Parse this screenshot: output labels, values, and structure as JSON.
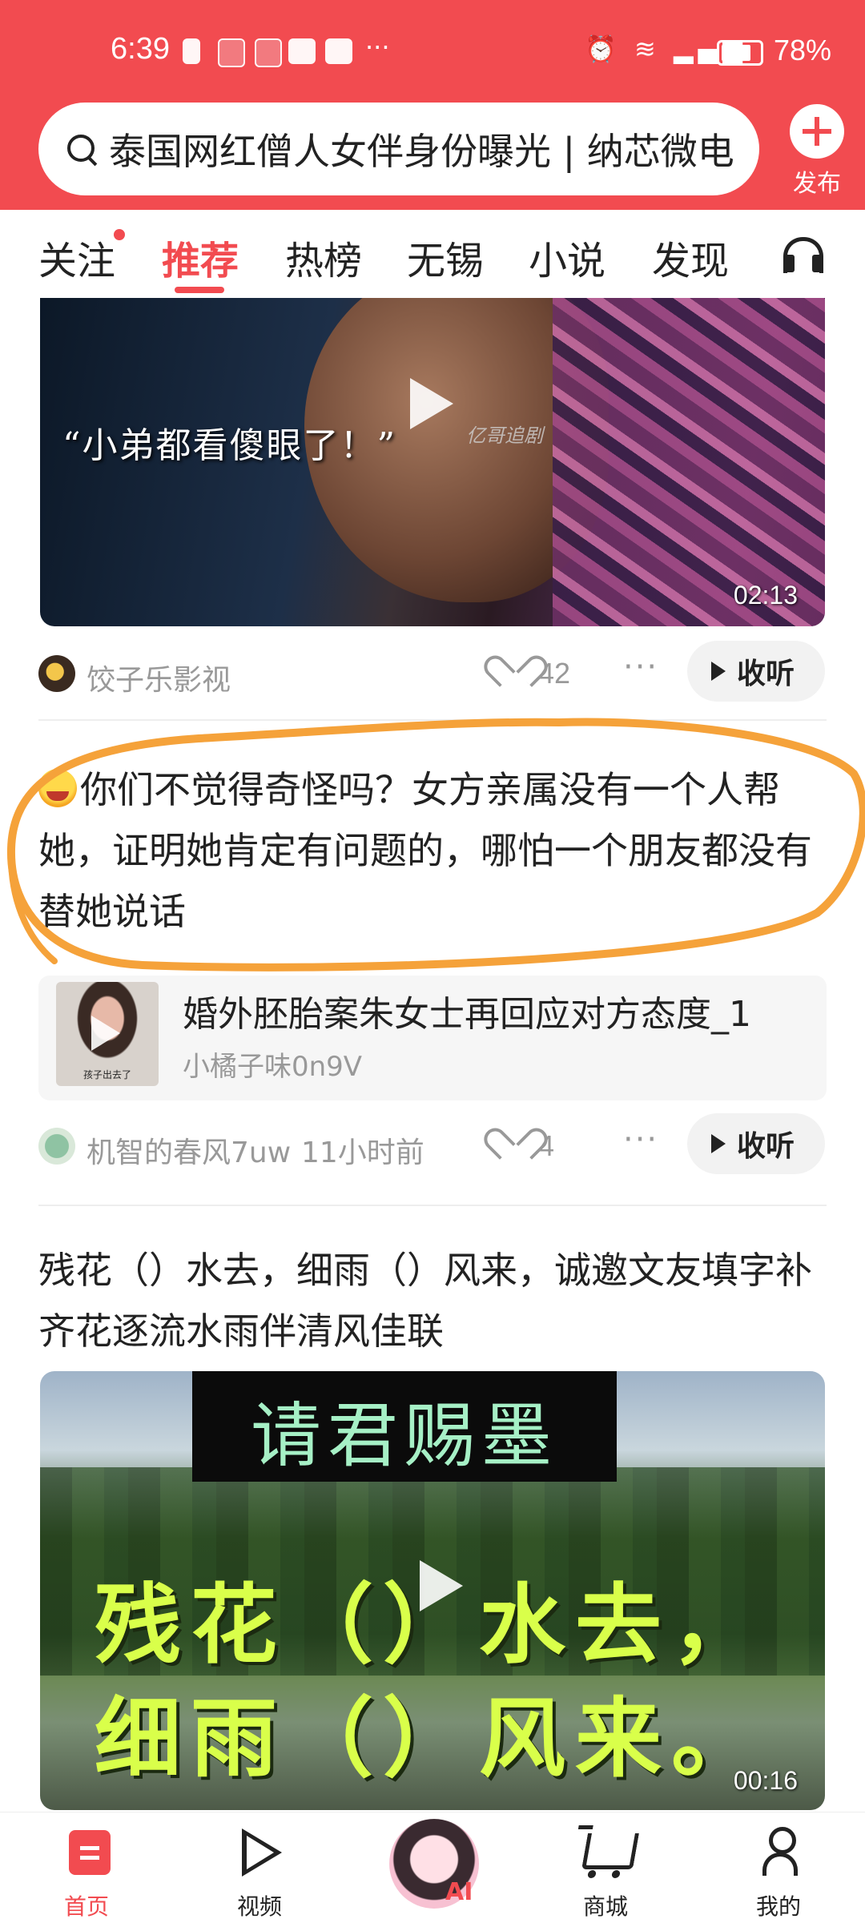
{
  "status_bar": {
    "time": "6:39",
    "battery": "78%",
    "battery_level": 0.78
  },
  "search": {
    "query": "泰国网红僧人女伴身份曝光 | 纳芯微电"
  },
  "publish": {
    "label": "发布"
  },
  "tabs": [
    {
      "label": "关注",
      "has_dot": true
    },
    {
      "label": "推荐",
      "active": true
    },
    {
      "label": "热榜"
    },
    {
      "label": "无锡"
    },
    {
      "label": "小说"
    },
    {
      "label": "发现"
    }
  ],
  "feed": {
    "item1": {
      "subtitle": "“小弟都看傻眼了！”",
      "watermark": "亿哥追剧",
      "duration": "02:13",
      "author": "饺子乐影视",
      "likes": "42",
      "listen_label": "收听"
    },
    "post": {
      "text": "你们不觉得奇怪吗？女方亲属没有一个人帮她，证明她肯定有问题的，哪怕一个朋友都没有替她说话",
      "quote": {
        "thumb_caption": "孩子出去了",
        "title": "婚外胚胎案朱女士再回应对方态度_1",
        "author": "小橘子味0n9V"
      },
      "author": "机智的春风7uw",
      "time_ago": "11小时前",
      "likes": "4",
      "listen_label": "收听"
    },
    "item3": {
      "text": "残花（）水去，细雨（）风来，诚邀文友填字补齐花逐流水雨伴清风佳联",
      "banner": "请君赐墨",
      "line1": "残花（）水去，",
      "line2": "细雨（）风来。",
      "duration": "00:16"
    }
  },
  "bottom_nav": {
    "home": "首页",
    "video": "视频",
    "ai": "AI",
    "mall": "商城",
    "me": "我的"
  },
  "colors": {
    "accent": "#f24b50",
    "annotation": "#f5a23a"
  }
}
